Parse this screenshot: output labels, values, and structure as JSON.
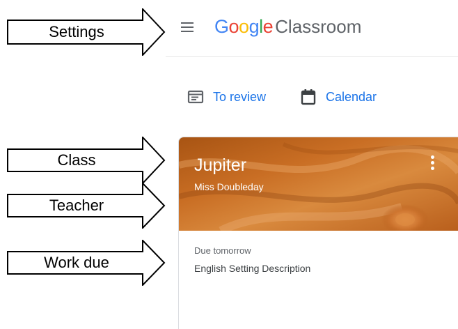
{
  "header": {
    "brand_letters": [
      {
        "char": "G",
        "color": "#4285F4"
      },
      {
        "char": "o",
        "color": "#EA4335"
      },
      {
        "char": "o",
        "color": "#FBBC05"
      },
      {
        "char": "g",
        "color": "#4285F4"
      },
      {
        "char": "l",
        "color": "#34A853"
      },
      {
        "char": "e",
        "color": "#EA4335"
      }
    ],
    "product_name": "Classroom",
    "menu_icon": "hamburger-icon"
  },
  "nav": {
    "review_label": "To review",
    "review_icon": "clipboard-icon",
    "calendar_label": "Calendar",
    "calendar_icon": "calendar-icon",
    "link_color": "#1a73e8"
  },
  "card": {
    "class_name": "Jupiter",
    "teacher": "Miss Doubleday",
    "due_label": "Due tomorrow",
    "assignment": "English Setting Description",
    "more_icon": "more-vert-icon",
    "banner_color": "#c0651a"
  },
  "callouts": {
    "settings": "Settings",
    "class": "Class",
    "teacher": "Teacher",
    "work_due": "Work due"
  }
}
